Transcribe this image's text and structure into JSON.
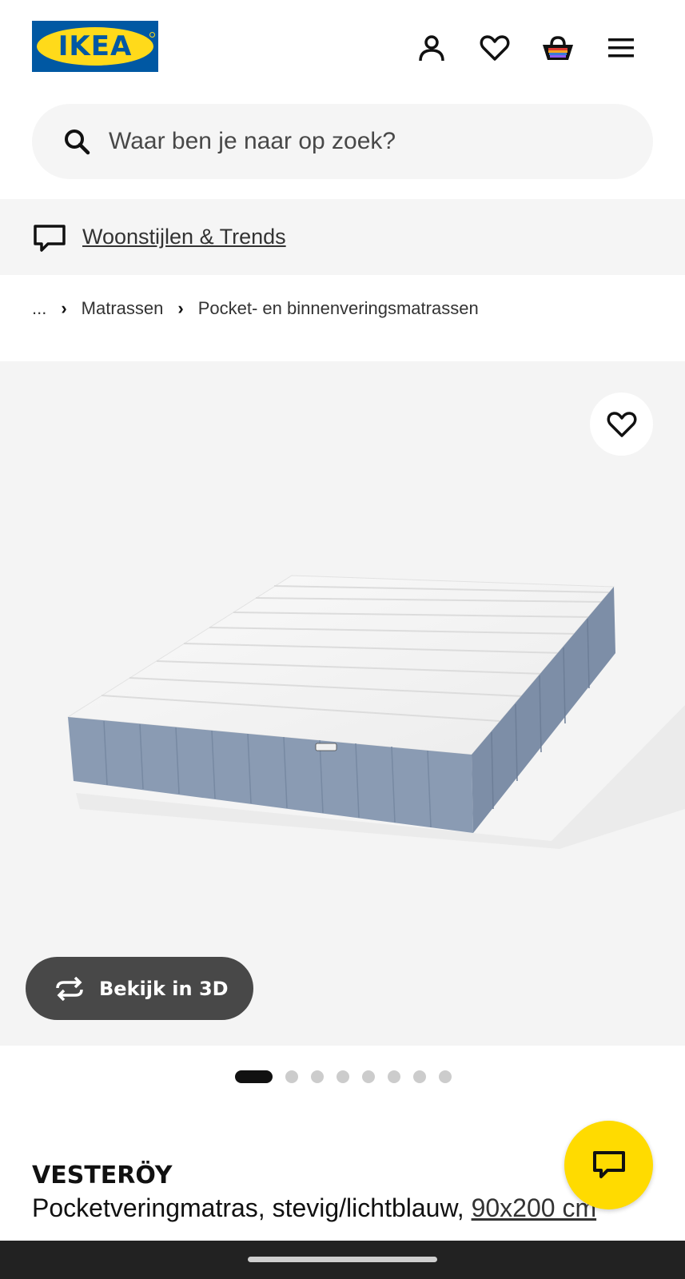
{
  "header": {
    "logo_text": "IKEA",
    "icons": [
      "account-icon",
      "heart-icon",
      "cart-icon",
      "menu-icon"
    ]
  },
  "search": {
    "placeholder": "Waar ben je naar op zoek?"
  },
  "trends": {
    "label": "Woonstijlen & Trends"
  },
  "breadcrumb": {
    "items": [
      "...",
      "Matrassen",
      "Pocket- en binnenveringsmatrassen"
    ]
  },
  "gallery": {
    "view_3d_label": "Bekijk in 3D",
    "total_images": 8,
    "active_index": 0
  },
  "product": {
    "name": "VESTERÖY",
    "description": "Pocketveringmatras, stevig/lichtblauw, ",
    "size": "90x200 cm"
  },
  "colors": {
    "brand_blue": "#0058a3",
    "brand_yellow": "#ffda1a",
    "chat_yellow": "#ffdb00",
    "mattress_blue": "#8a9bb3"
  }
}
